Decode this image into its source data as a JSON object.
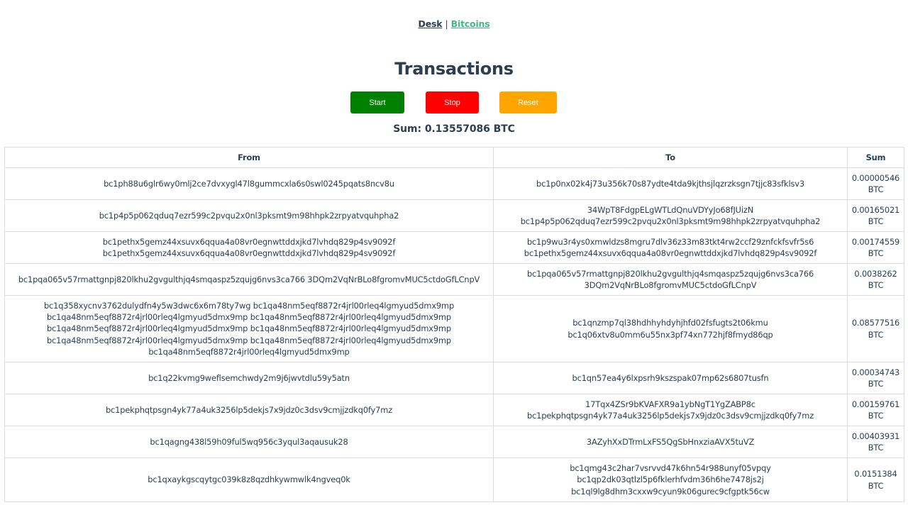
{
  "nav": {
    "desk_label": "Desk",
    "separator": "|",
    "bitcoins_label": "Bitcoins"
  },
  "page_title": "Transactions",
  "buttons": {
    "start_label": "Start",
    "stop_label": "Stop",
    "reset_label": "Reset"
  },
  "colors": {
    "start": "#008000",
    "stop": "#ff0000",
    "reset": "#ffa500",
    "link_active": "#2c3e50",
    "link_accent": "#42b983",
    "text": "#2c3e50"
  },
  "sum_text": "Sum: 0.13557086 BTC",
  "table": {
    "headers": [
      "From",
      "To",
      "Sum"
    ],
    "rows": [
      {
        "height": 45,
        "from": [
          "bc1ph88u6glr6wy0mlj2ce7dvxygl47l8gummcxla6s0swl0245pqats8ncv8u"
        ],
        "to": [
          "bc1p0nx02k4j73u356k70s87ydte4tda9kjthsjlqzrzksgn7tjjc83sfklsv3"
        ],
        "sum": "0.00000546 BTC"
      },
      {
        "height": 45,
        "from": [
          "bc1p4p5p062qduq7ezr599c2pvqu2x0nl3pksmt9m98hhpk2zrpyatvquhpha2"
        ],
        "to": [
          "34WpT8FdgpELgWTLdQnuVDYyJo68fJUizN",
          "bc1p4p5p062qduq7ezr599c2pvqu2x0nl3pksmt9m98hhpk2zrpyatvquhpha2"
        ],
        "sum": "0.00165021 BTC"
      },
      {
        "height": 45,
        "from": [
          "bc1pethx5gemz44xsuvx6qqua4a08vr0egnwttddxjkd7lvhdq829p4sv9092f",
          "bc1pethx5gemz44xsuvx6qqua4a08vr0egnwttddxjkd7lvhdq829p4sv9092f"
        ],
        "to": [
          "bc1p9wu3r4ys0xmwldzs8mgru7dlv36z33m83tkt4rw2ccf29znfckfsvfr5s6",
          "bc1pethx5gemz44xsuvx6qqua4a08vr0egnwttddxjkd7lvhdq829p4sv9092f"
        ],
        "sum": "0.00174559 BTC"
      },
      {
        "height": 45,
        "from": [
          "bc1pqa065v57rmattgnpj820lkhu2gvgulthjq4smqaspz5zqujg6nvs3ca766 3DQm2VqNrBLo8fgromvMUC5ctdoGfLCnpV"
        ],
        "to": [
          "bc1pqa065v57rmattgnpj820lkhu2gvgulthjq4smqaspz5zqujg6nvs3ca766",
          "3DQm2VqNrBLo8fgromvMUC5ctdoGfLCnpV"
        ],
        "sum": "0.0038262 BTC"
      },
      {
        "height": 94,
        "from": [
          "bc1q358xycnv3762dulydfn4y5w3dwc6x6m78ty7wg bc1qa48nm5eqf8872r4jrl00rleq4lgmyud5dmx9mp",
          "bc1qa48nm5eqf8872r4jrl00rleq4lgmyud5dmx9mp bc1qa48nm5eqf8872r4jrl00rleq4lgmyud5dmx9mp",
          "bc1qa48nm5eqf8872r4jrl00rleq4lgmyud5dmx9mp bc1qa48nm5eqf8872r4jrl00rleq4lgmyud5dmx9mp",
          "bc1qa48nm5eqf8872r4jrl00rleq4lgmyud5dmx9mp bc1qa48nm5eqf8872r4jrl00rleq4lgmyud5dmx9mp",
          "bc1qa48nm5eqf8872r4jrl00rleq4lgmyud5dmx9mp"
        ],
        "to": [
          "bc1qnzmp7ql38hdhhyhdyhjhfd02fsfugts2t06kmu",
          "bc1q06xtv8u0mm6u55nx3pf74xn772hjf8fmyd86qp"
        ],
        "sum": "0.08577516 BTC"
      },
      {
        "height": 45,
        "from": [
          "bc1q22kvmg9weflsemchwdy2m9j6jwvtdlu59y5atn"
        ],
        "to": [
          "bc1qn57ea4y6lxpsrh9kszspak07mp62s6807tusfn"
        ],
        "sum": "0.00034743 BTC"
      },
      {
        "height": 45,
        "from": [
          "bc1pekphqtpsgn4yk77a4uk3256lp5dekjs7x9jdz0c3dsv9cmjjzdkq0fy7mz"
        ],
        "to": [
          "17Tqx4ZSr9bKVAFXR9a1ybNgT1YgZABP8c",
          "bc1pekphqtpsgn4yk77a4uk3256lp5dekjs7x9jdz0c3dsv9cmjjzdkq0fy7mz"
        ],
        "sum": "0.00159761 BTC"
      },
      {
        "height": 45,
        "from": [
          "bc1qagng438l59h09ful5wq956c3yqul3aqausuk28"
        ],
        "to": [
          "3AZyhXxDTrmLxFS5QgSbHnxziaAVX5tuVZ"
        ],
        "sum": "0.00403931 BTC"
      },
      {
        "height": 62,
        "from": [
          "bc1qxaykgscqytgc039k8z8qzdhkywmwlk4ngveq0k"
        ],
        "to": [
          "bc1qmg43c2har7vsrvvd47k6hn54r988unyf05vpqy",
          "bc1qp2dk03qtlzl5p6fklerhfvdm36h6he7478js2j",
          "bc1ql9lg8dhm3cxxw9cyun9k06gurec9cfgptk56cw"
        ],
        "sum": "0.0151384 BTC"
      }
    ]
  }
}
